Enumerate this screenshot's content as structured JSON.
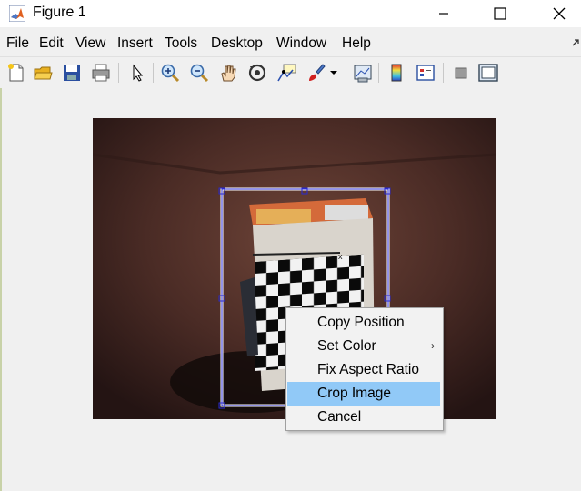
{
  "window": {
    "title": "Figure 1"
  },
  "menubar": {
    "items": [
      "File",
      "Edit",
      "View",
      "Insert",
      "Tools",
      "Desktop",
      "Window",
      "Help"
    ]
  },
  "toolbar": {
    "icons": [
      "new-figure-icon",
      "open-file-icon",
      "save-icon",
      "print-icon",
      "edit-plot-arrow-icon",
      "zoom-in-icon",
      "zoom-out-icon",
      "pan-hand-icon",
      "rotate-3d-icon",
      "data-cursor-icon",
      "brush-icon",
      "brush-dropdown-icon",
      "link-plot-icon",
      "colorbar-icon",
      "legend-icon",
      "hide-plot-tools-icon",
      "show-plot-tools-icon"
    ]
  },
  "context_menu": {
    "items": [
      {
        "label": "Copy Position",
        "submenu": false,
        "highlighted": false
      },
      {
        "label": "Set Color",
        "submenu": true,
        "highlighted": false
      },
      {
        "label": "Fix Aspect Ratio",
        "submenu": false,
        "highlighted": false
      },
      {
        "label": "Crop Image",
        "submenu": false,
        "highlighted": true
      },
      {
        "label": "Cancel",
        "submenu": false,
        "highlighted": false
      }
    ]
  },
  "roi": {
    "color": "#2a2ad0"
  }
}
